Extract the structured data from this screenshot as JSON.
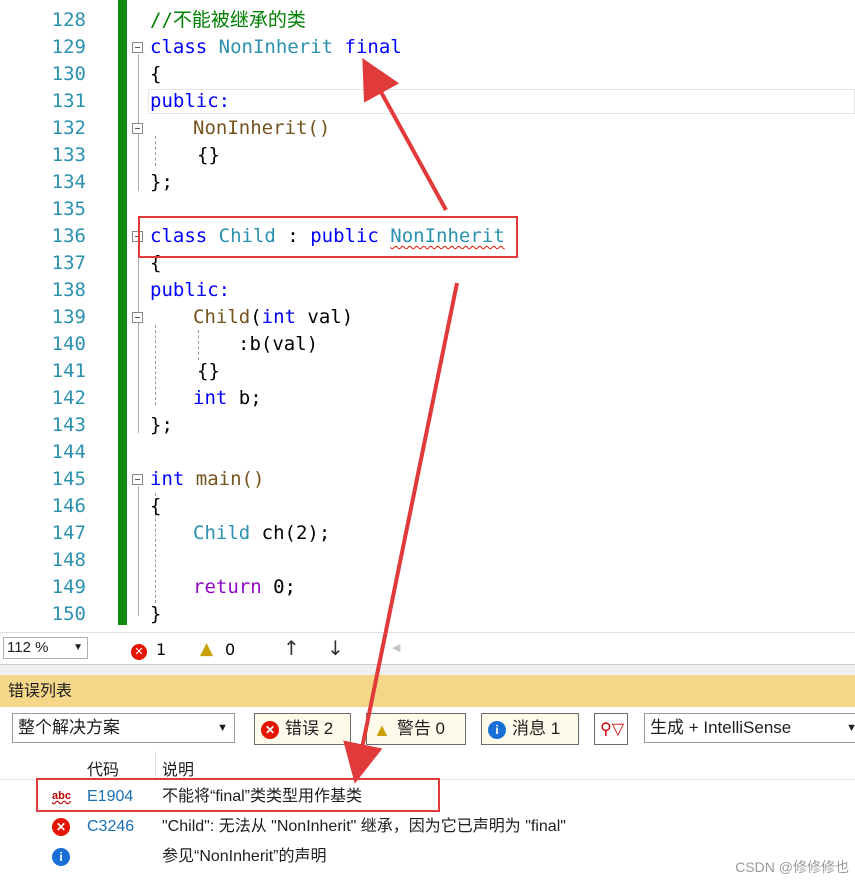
{
  "editor": {
    "lines": [
      {
        "num": "128"
      },
      {
        "num": "129"
      },
      {
        "num": "130"
      },
      {
        "num": "131"
      },
      {
        "num": "132"
      },
      {
        "num": "133"
      },
      {
        "num": "134"
      },
      {
        "num": "135"
      },
      {
        "num": "136"
      },
      {
        "num": "137"
      },
      {
        "num": "138"
      },
      {
        "num": "139"
      },
      {
        "num": "140"
      },
      {
        "num": "141"
      },
      {
        "num": "142"
      },
      {
        "num": "143"
      },
      {
        "num": "144"
      },
      {
        "num": "145"
      },
      {
        "num": "146"
      },
      {
        "num": "147"
      },
      {
        "num": "148"
      },
      {
        "num": "149"
      },
      {
        "num": "150"
      }
    ],
    "code": {
      "l128": "//不能被继承的类",
      "l129_kw": "class",
      "l129_ty": "NonInherit",
      "l129_kw2": "final",
      "l130": "{",
      "l131": "public:",
      "l132": "NonInherit()",
      "l133": "{}",
      "l134": "};",
      "l136_kw": "class",
      "l136_ty": "Child",
      "l136_sep": " : ",
      "l136_kw2": "public",
      "l136_ty2": "NonInherit",
      "l137": "{",
      "l138": "public:",
      "l139_fn": "Child",
      "l139_paren": "(",
      "l139_kw": "int",
      "l139_rest": " val)",
      "l140": ":b(val)",
      "l141": "{}",
      "l142_kw": "int",
      "l142_rest": " b;",
      "l143": "};",
      "l145_kw": "int",
      "l145_fn": " main()",
      "l146": "{",
      "l147_ty": "Child",
      "l147_rest": " ch(2);",
      "l149_kw": "return",
      "l149_rest": " 0;",
      "l150": "}"
    }
  },
  "status": {
    "zoom": "112 %",
    "errors": "1",
    "warnings": "0"
  },
  "error_list": {
    "title": "错误列表",
    "scope": "整个解决方案",
    "errors_btn": "错误 2",
    "warnings_btn": "警告 0",
    "messages_btn": "消息 1",
    "build_filter": "生成 + IntelliSense",
    "columns": {
      "code": "代码",
      "desc": "说明"
    },
    "rows": [
      {
        "icon": "abc",
        "code": "E1904",
        "desc": "不能将“final”类类型用作基类"
      },
      {
        "icon": "error",
        "code": "C3246",
        "desc": "\"Child\": 无法从 \"NonInherit\" 继承，因为它已声明为 \"final\""
      },
      {
        "icon": "info",
        "code": "",
        "desc": "参见“NonInherit”的声明"
      }
    ]
  },
  "watermark": "CSDN @修修修也",
  "colors": {
    "accent_red": "#e03a3a",
    "panel_title_bg": "#f5d78a",
    "change_bar": "#108a10"
  }
}
